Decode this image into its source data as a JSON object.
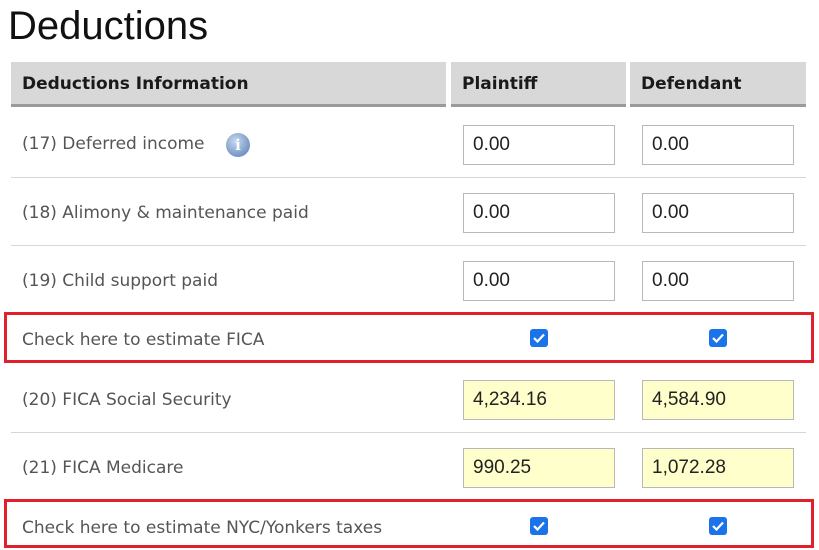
{
  "page": {
    "title": "Deductions"
  },
  "table": {
    "headers": {
      "info": "Deductions Information",
      "plaintiff": "Plaintiff",
      "defendant": "Defendant"
    },
    "rows": [
      {
        "label": "(17) Deferred income",
        "plaintiff": "0.00",
        "defendant": "0.00"
      },
      {
        "label": "(18) Alimony & maintenance paid",
        "plaintiff": "0.00",
        "defendant": "0.00"
      },
      {
        "label": "(19) Child support paid",
        "plaintiff": "0.00",
        "defendant": "0.00"
      },
      {
        "label": "Check here to estimate FICA",
        "plaintiff_checked": true,
        "defendant_checked": true
      },
      {
        "label": "(20) FICA Social Security",
        "plaintiff": "4,234.16",
        "defendant": "4,584.90"
      },
      {
        "label": "(21) FICA Medicare",
        "plaintiff": "990.25",
        "defendant": "1,072.28"
      },
      {
        "label": "Check here to estimate NYC/Yonkers taxes",
        "plaintiff_checked": true,
        "defendant_checked": true
      }
    ]
  },
  "icons": {
    "info": "info-icon",
    "info_glyph": "i",
    "checkbox": "checkmark-icon"
  },
  "colors": {
    "header_bg": "#d8d8d8",
    "highlight_border": "#e0202b",
    "auto_field_bg": "#ffffcc",
    "checkbox_blue": "#1a73e8"
  }
}
